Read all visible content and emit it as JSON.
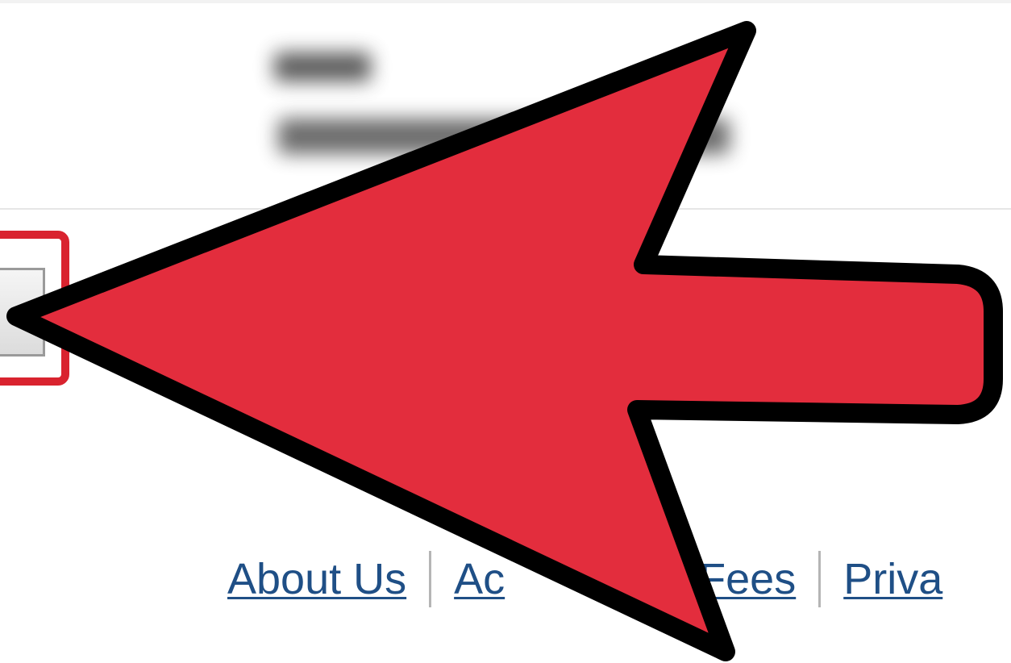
{
  "header": {
    "blurred_text": ""
  },
  "action_button": {
    "label": ""
  },
  "footer": {
    "links": [
      {
        "label": "About Us"
      },
      {
        "label": "Ac"
      },
      {
        "label": "Fees"
      },
      {
        "label": "Priva"
      }
    ]
  },
  "annotation": {
    "arrow_icon": "pointer-arrow-icon",
    "highlight_color": "#d9232f",
    "arrow_fill": "#e32d3d",
    "arrow_stroke": "#000000"
  }
}
